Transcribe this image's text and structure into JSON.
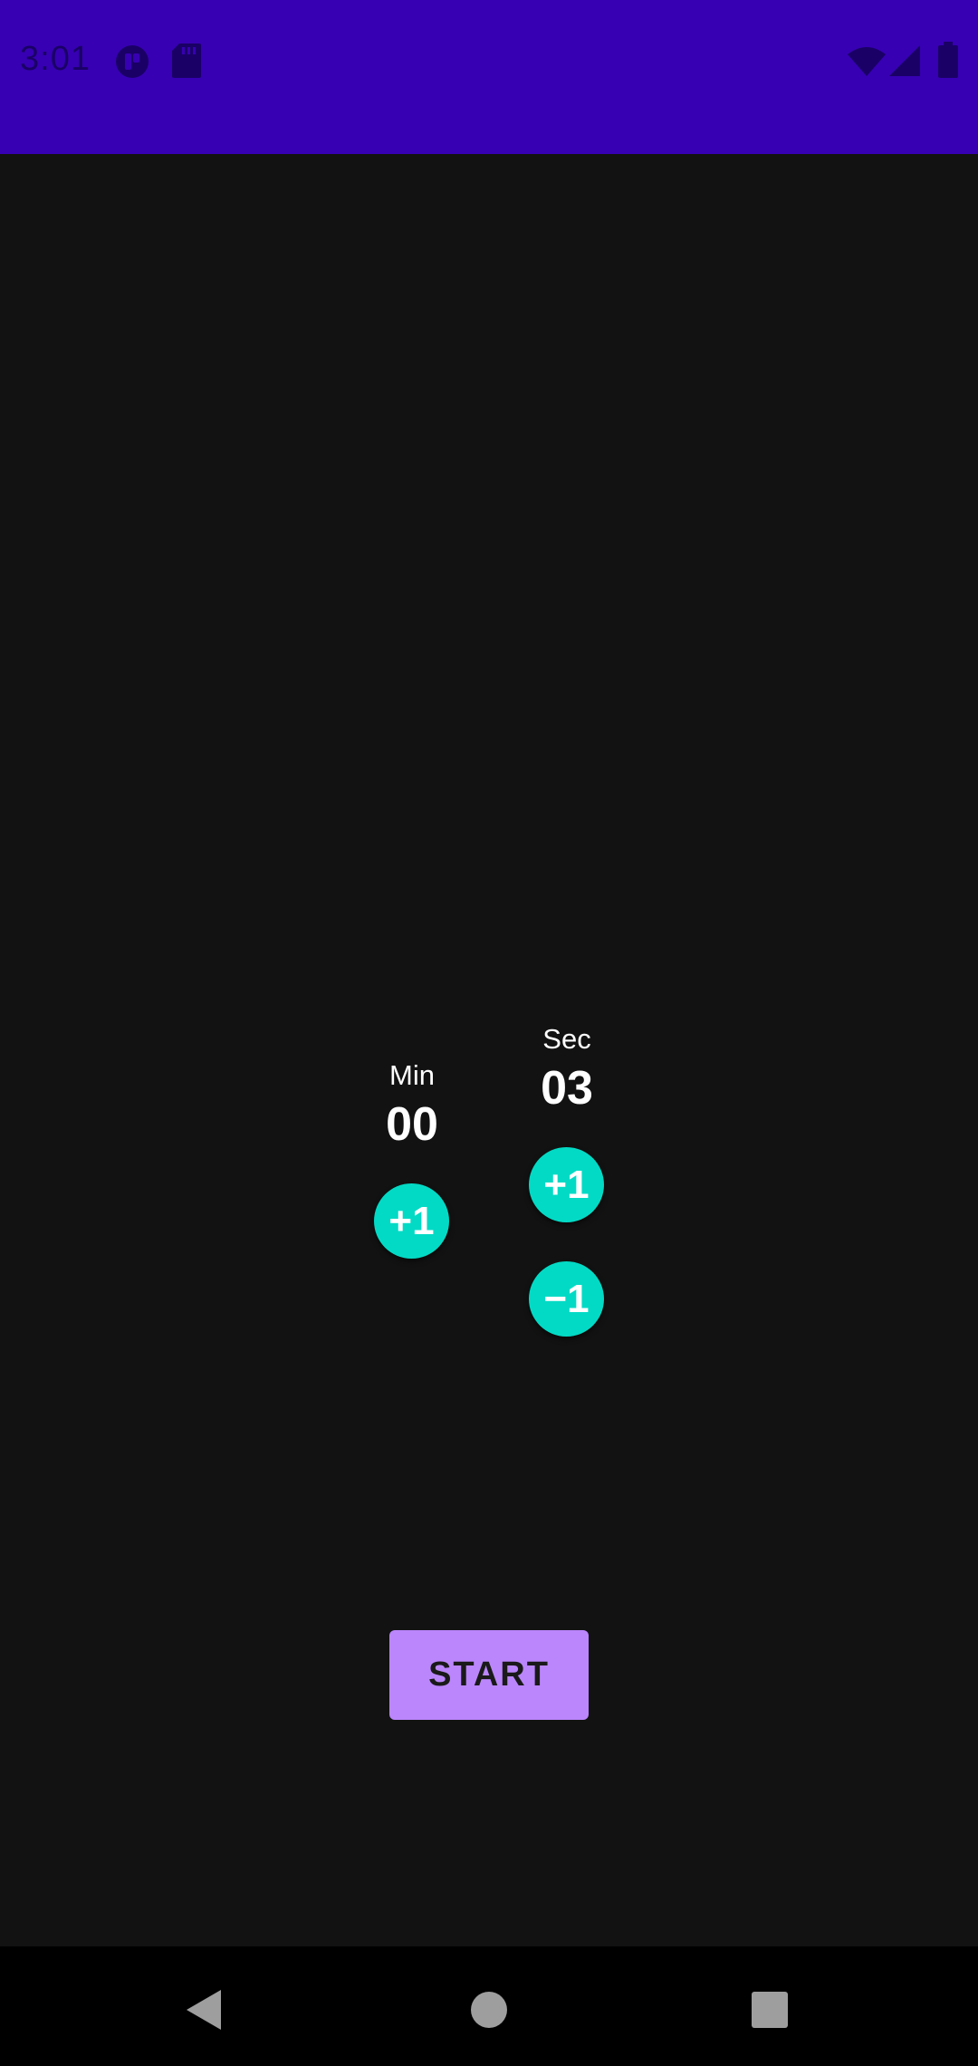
{
  "status_bar": {
    "time": "3:01",
    "left_icons": [
      "app-notification-icon",
      "sd-card-icon"
    ],
    "right_icons": [
      "wifi-icon",
      "signal-icon",
      "battery-icon"
    ],
    "background": "#3700b3"
  },
  "timer": {
    "minutes": {
      "label": "Min",
      "value": "00",
      "increment_label": "+1"
    },
    "seconds": {
      "label": "Sec",
      "value": "03",
      "increment_label": "+1",
      "decrement_label": "−1"
    }
  },
  "start_button": {
    "label": "START",
    "color": "#bb86fc"
  },
  "colors": {
    "accent": "#03dac5",
    "background": "#121212"
  },
  "nav_bar": {
    "buttons": [
      "back-icon",
      "home-icon",
      "recents-icon"
    ]
  }
}
